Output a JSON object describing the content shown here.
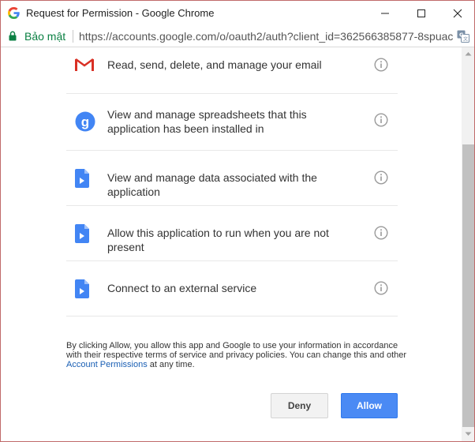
{
  "window": {
    "title": "Request for Permission - Google Chrome"
  },
  "address_bar": {
    "secure_label": "Bảo mật",
    "url": "https://accounts.google.com/o/oauth2/auth?client_id=362566385877-8spuac"
  },
  "scopes": [
    {
      "icon": "gmail-icon",
      "text": "Read, send, delete, and manage your email"
    },
    {
      "icon": "google-g-icon",
      "text": "View and manage spreadsheets that this application has been installed in"
    },
    {
      "icon": "document-icon",
      "text": "View and manage data associated with the application"
    },
    {
      "icon": "document-icon",
      "text": "Allow this application to run when you are not present"
    },
    {
      "icon": "document-icon",
      "text": "Connect to an external service"
    }
  ],
  "consent": {
    "text_before_link": "By clicking Allow, you allow this app and Google to use your information in accordance with their respective terms of service and privacy policies. You can change this and other ",
    "link_text": "Account Permissions",
    "text_after_link": " at any time."
  },
  "buttons": {
    "deny": "Deny",
    "allow": "Allow"
  },
  "colors": {
    "secure_green": "#0b8043",
    "allow_blue": "#4a8af4",
    "link_blue": "#1a5fb4",
    "window_border": "#c06a6a"
  }
}
